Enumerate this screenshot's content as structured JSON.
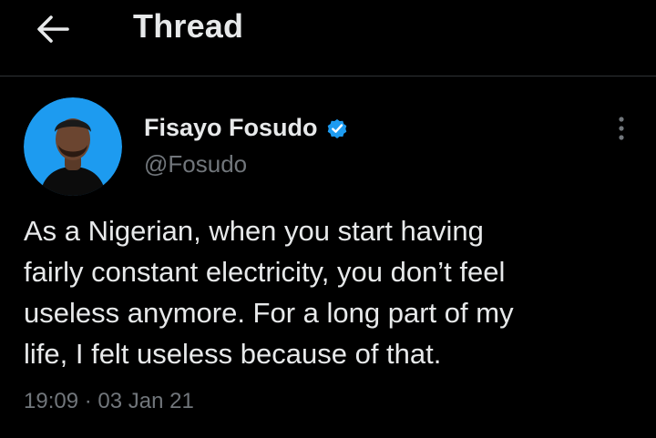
{
  "header": {
    "back_icon": "arrow-left-icon",
    "title": "Thread"
  },
  "tweet": {
    "author": {
      "display_name": "Fisayo Fosudo",
      "handle": "@Fosudo",
      "verified": true,
      "verified_icon": "verified-badge-icon",
      "avatar_bg": "#1d9bf0"
    },
    "more_icon": "more-vertical-icon",
    "text": "As a Nigerian, when you start having\nfairly constant electricity, you don’t feel\nuseless anymore. For a long part of my\nlife, I felt useless because of that.",
    "time": "19:09",
    "separator": "·",
    "date": "03 Jan 21"
  },
  "colors": {
    "background": "#000000",
    "text_primary": "#e7e9ea",
    "text_secondary": "#71767b",
    "divider": "#2f3336",
    "accent": "#1d9bf0"
  }
}
